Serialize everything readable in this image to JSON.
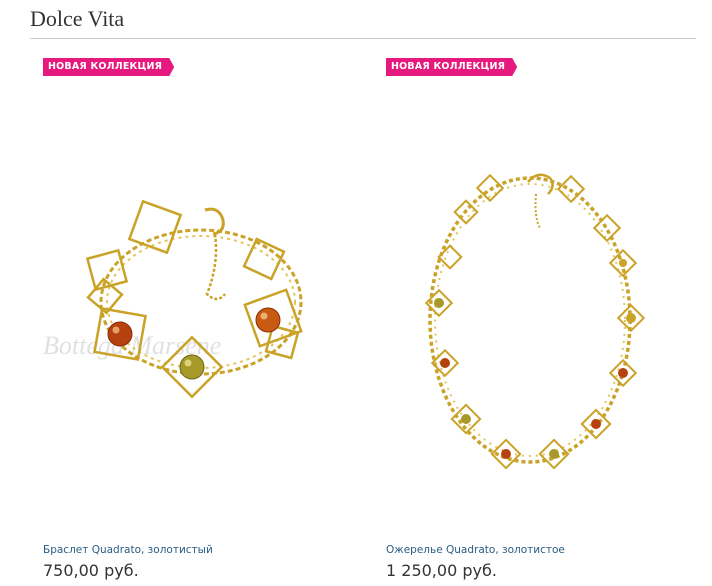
{
  "page": {
    "title": "Dolce Vita"
  },
  "products": [
    {
      "badge": "НОВАЯ КОЛЛЕКЦИЯ",
      "name": "Браслет Quadrato, золотистый",
      "price": "750,00 руб.",
      "image_icon": "amber-bracelet-image",
      "watermark": "Bottega Marsene"
    },
    {
      "badge": "НОВАЯ КОЛЛЕКЦИЯ",
      "name": "Ожерелье Quadrato, золотистое",
      "price": "1 250,00 руб.",
      "image_icon": "amber-necklace-image"
    }
  ],
  "colors": {
    "badge": "#e5197e",
    "link": "#2a5d83",
    "gold": "#c9a227",
    "amber": "#b5420e"
  }
}
